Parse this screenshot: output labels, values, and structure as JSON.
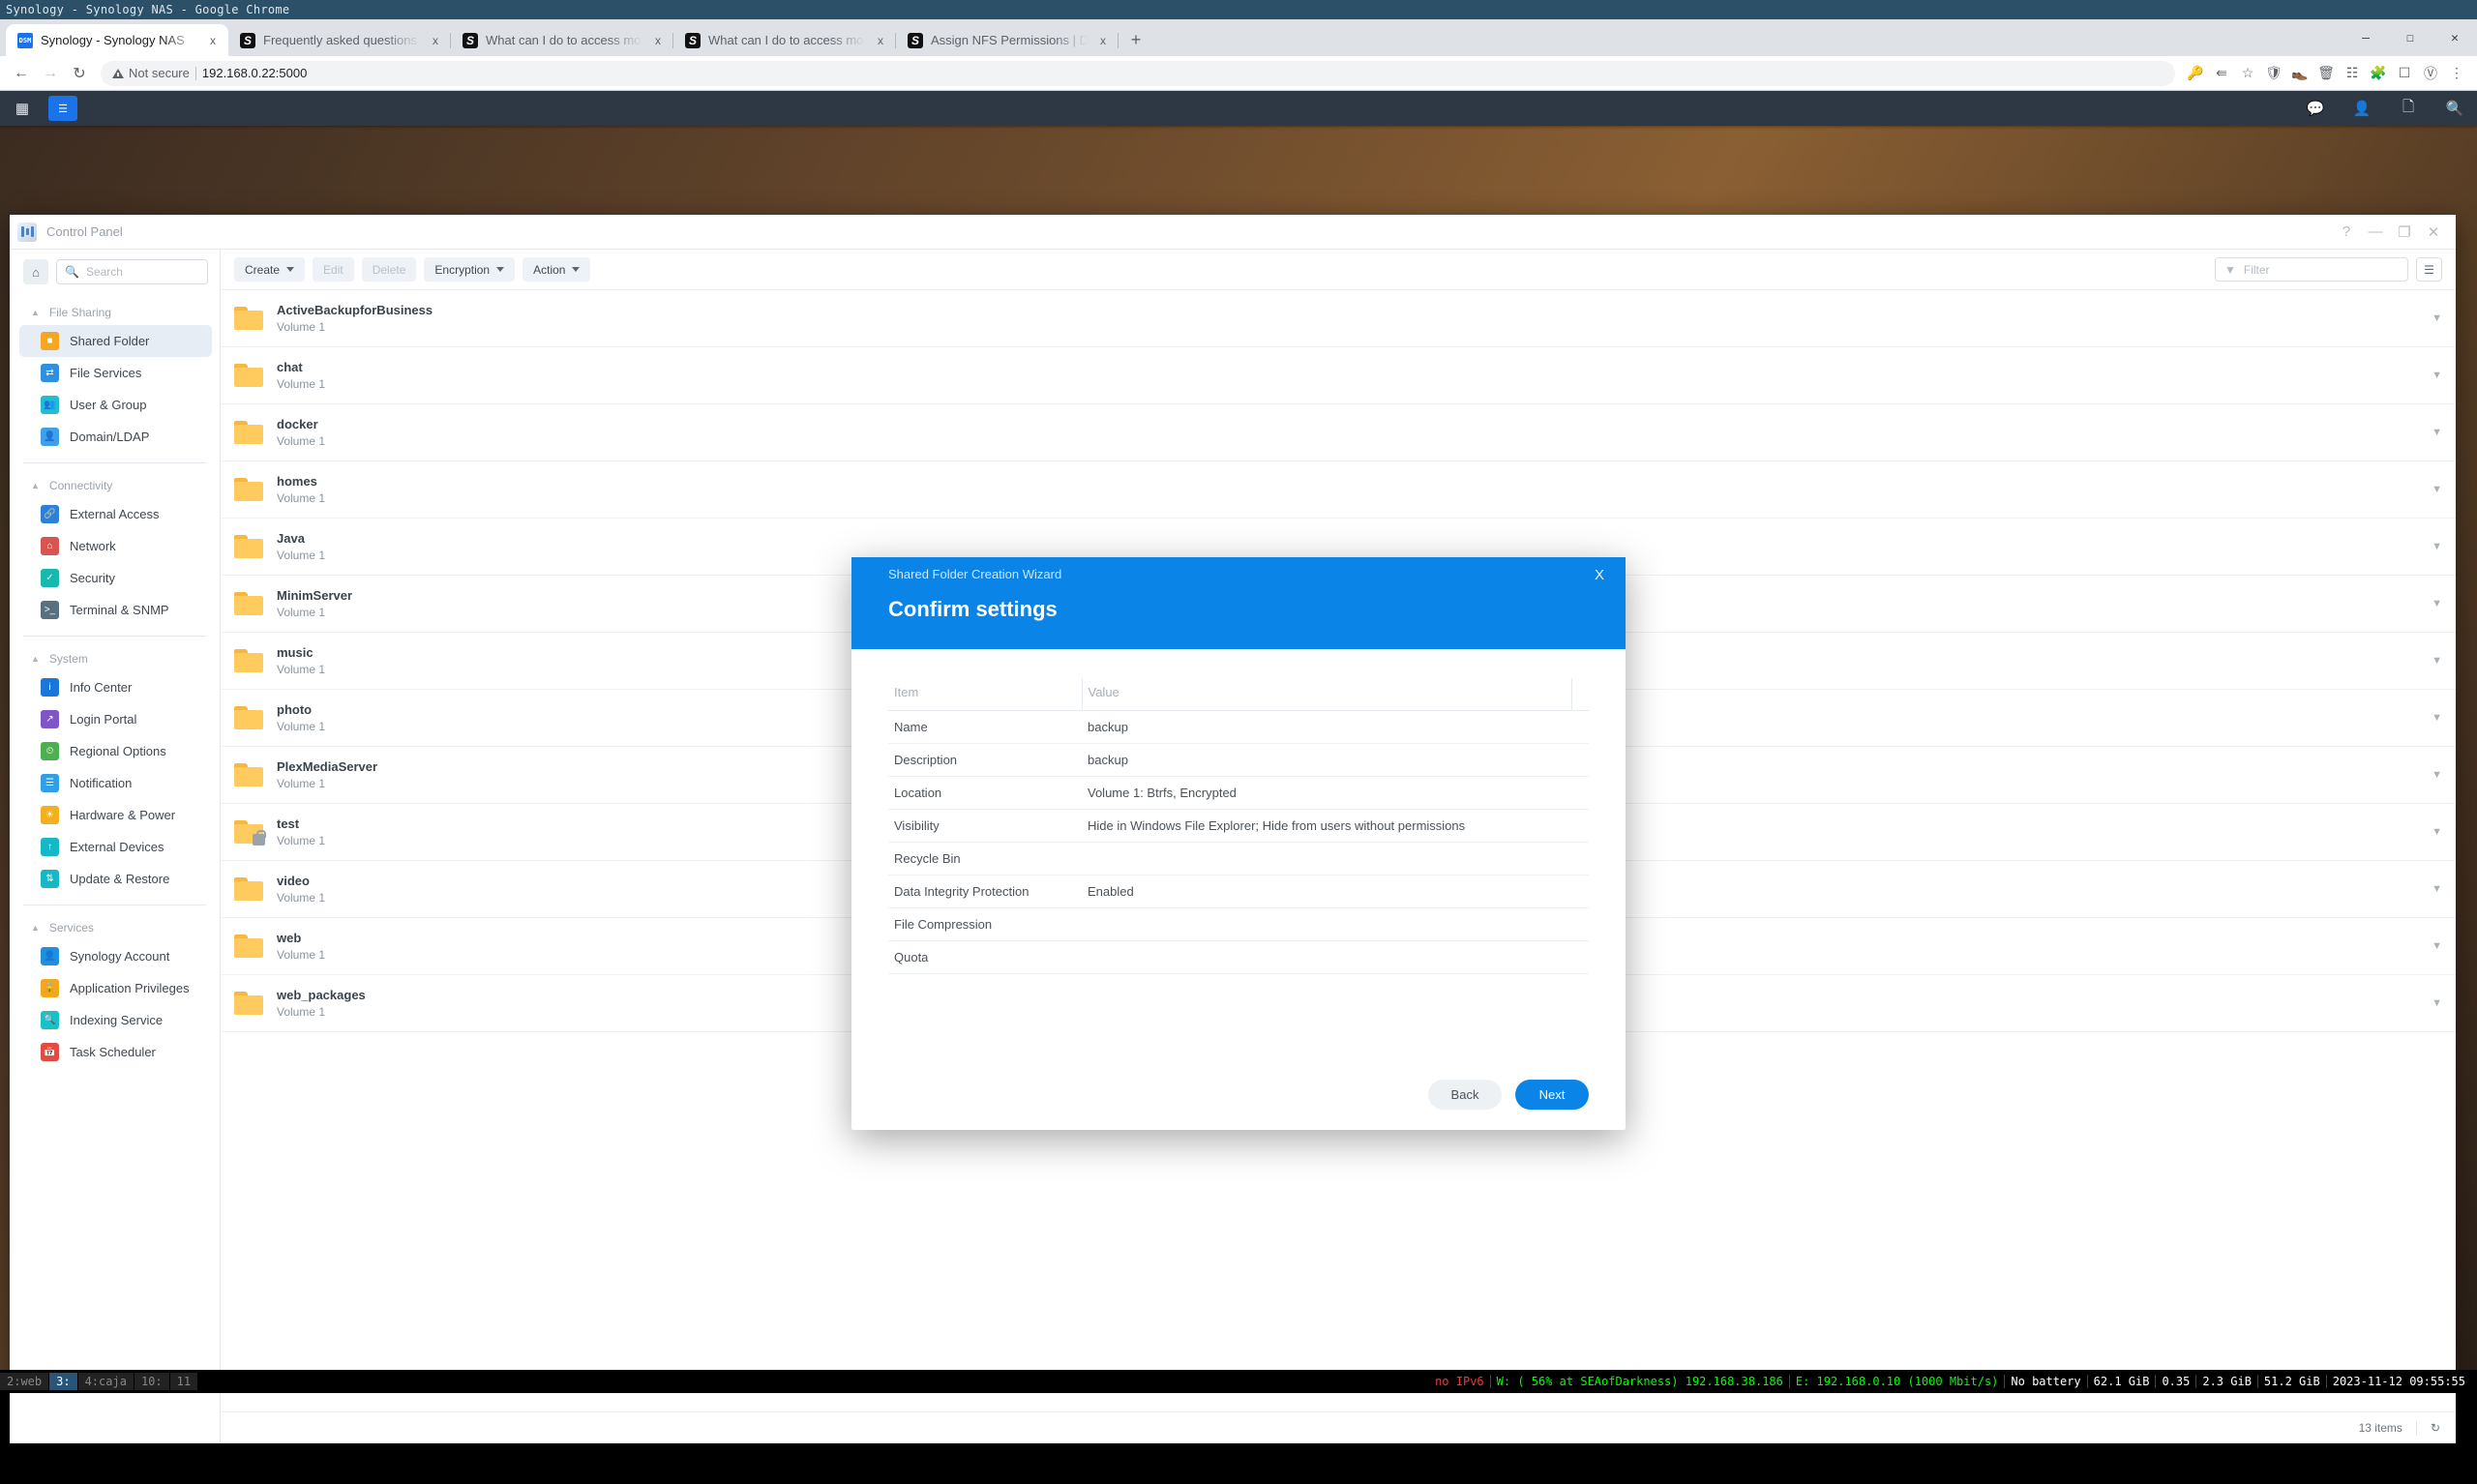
{
  "chrome": {
    "window_title": "Synology - Synology NAS - Google Chrome",
    "tabs": [
      {
        "title": "Synology - Synology NAS",
        "favicon": "synology-icon",
        "active": true
      },
      {
        "title": "Frequently asked questions a",
        "favicon": "s-icon",
        "active": false
      },
      {
        "title": "What can I do to access mou",
        "favicon": "s-icon",
        "active": false
      },
      {
        "title": "What can I do to access mou",
        "favicon": "s-icon",
        "active": false
      },
      {
        "title": "Assign NFS Permissions | DS",
        "favicon": "s-icon",
        "active": false
      }
    ],
    "close_label": "x",
    "new_tab_label": "+",
    "window_buttons": [
      "—",
      "☐",
      "✕"
    ],
    "nav": {
      "back": "←",
      "forward": "→",
      "reload": "↻"
    },
    "omnibox": {
      "security_text": "Not secure",
      "url": "192.168.0.22:5000"
    },
    "toolbar_icons": [
      "key-icon",
      "share-icon",
      "star-icon",
      "ublock-icon",
      "shoe-icon",
      "trash-icon",
      "equalizer-icon",
      "extensions-icon",
      "sidepanel-icon",
      "profile-icon",
      "menu-icon"
    ]
  },
  "dsm_taskbar": {
    "left_icons": [
      "apps-grid-icon",
      "control-panel-app-icon"
    ],
    "right_icons": [
      "chat-icon",
      "user-icon",
      "notifications-icon",
      "search-icon"
    ]
  },
  "control_panel": {
    "title": "Control Panel",
    "window_buttons": [
      "?",
      "—",
      "❐",
      "✕"
    ],
    "search_placeholder": "Search",
    "home_icon": "home-icon",
    "search_icon": "search-icon",
    "sidebar": [
      {
        "group": "File Sharing",
        "items": [
          {
            "label": "Shared Folder",
            "icon": "shared-folder-icon",
            "color": "#f5a623",
            "selected": true
          },
          {
            "label": "File Services",
            "icon": "file-services-icon",
            "color": "#2f8fe0",
            "selected": false
          },
          {
            "label": "User & Group",
            "icon": "user-group-icon",
            "color": "#1fbcd2",
            "selected": false
          },
          {
            "label": "Domain/LDAP",
            "icon": "domain-ldap-icon",
            "color": "#3f9fe8",
            "selected": false
          }
        ]
      },
      {
        "group": "Connectivity",
        "items": [
          {
            "label": "External Access",
            "icon": "external-access-icon",
            "color": "#2f7fd6",
            "selected": false
          },
          {
            "label": "Network",
            "icon": "network-icon",
            "color": "#d9534f",
            "selected": false
          },
          {
            "label": "Security",
            "icon": "security-icon",
            "color": "#17b8ae",
            "selected": false
          },
          {
            "label": "Terminal & SNMP",
            "icon": "terminal-snmp-icon",
            "color": "#58707f",
            "selected": false
          }
        ]
      },
      {
        "group": "System",
        "items": [
          {
            "label": "Info Center",
            "icon": "info-center-icon",
            "color": "#1b76d9",
            "selected": false
          },
          {
            "label": "Login Portal",
            "icon": "login-portal-icon",
            "color": "#8055c8",
            "selected": false
          },
          {
            "label": "Regional Options",
            "icon": "regional-options-icon",
            "color": "#4caf50",
            "selected": false
          },
          {
            "label": "Notification",
            "icon": "notification-icon",
            "color": "#2f9fe8",
            "selected": false
          },
          {
            "label": "Hardware & Power",
            "icon": "hardware-power-icon",
            "color": "#f2b01e",
            "selected": false
          },
          {
            "label": "External Devices",
            "icon": "external-devices-icon",
            "color": "#17b8c5",
            "selected": false
          },
          {
            "label": "Update & Restore",
            "icon": "update-restore-icon",
            "color": "#17b8c5",
            "selected": false
          }
        ]
      },
      {
        "group": "Services",
        "items": [
          {
            "label": "Synology Account",
            "icon": "synology-account-icon",
            "color": "#1f8fe0",
            "selected": false
          },
          {
            "label": "Application Privileges",
            "icon": "application-privileges-icon",
            "color": "#f2a71e",
            "selected": false
          },
          {
            "label": "Indexing Service",
            "icon": "indexing-service-icon",
            "color": "#18c0c7",
            "selected": false
          },
          {
            "label": "Task Scheduler",
            "icon": "task-scheduler-icon",
            "color": "#e04b42",
            "selected": false
          }
        ]
      }
    ],
    "toolbar": {
      "create": "Create",
      "edit": "Edit",
      "delete": "Delete",
      "encryption": "Encryption",
      "action": "Action",
      "filter_placeholder": "Filter",
      "filter_icon": "funnel-icon",
      "list_view_icon": "list-view-icon"
    },
    "folders": [
      {
        "name": "ActiveBackupforBusiness",
        "volume": "Volume 1",
        "locked": false
      },
      {
        "name": "chat",
        "volume": "Volume 1",
        "locked": false
      },
      {
        "name": "docker",
        "volume": "Volume 1",
        "locked": false
      },
      {
        "name": "homes",
        "volume": "Volume 1",
        "locked": false
      },
      {
        "name": "Java",
        "volume": "Volume 1",
        "locked": false
      },
      {
        "name": "MinimServer",
        "volume": "Volume 1",
        "locked": false
      },
      {
        "name": "music",
        "volume": "Volume 1",
        "locked": false
      },
      {
        "name": "photo",
        "volume": "Volume 1",
        "locked": false
      },
      {
        "name": "PlexMediaServer",
        "volume": "Volume 1",
        "locked": false
      },
      {
        "name": "test",
        "volume": "Volume 1",
        "locked": true
      },
      {
        "name": "video",
        "volume": "Volume 1",
        "locked": false
      },
      {
        "name": "web",
        "volume": "Volume 1",
        "locked": false
      },
      {
        "name": "web_packages",
        "volume": "Volume 1",
        "locked": false
      }
    ],
    "status": {
      "item_count": "13 items",
      "refresh_icon": "refresh-icon"
    }
  },
  "modal": {
    "wizard_name": "Shared Folder Creation Wizard",
    "title": "Confirm settings",
    "close_label": "X",
    "accent_color": "#0b84e8",
    "table": {
      "headers": [
        "Item",
        "Value"
      ],
      "rows": [
        {
          "item": "Name",
          "value": "backup"
        },
        {
          "item": "Description",
          "value": "backup"
        },
        {
          "item": "Location",
          "value": "Volume 1: Btrfs, Encrypted"
        },
        {
          "item": "Visibility",
          "value": "Hide in Windows File Explorer; Hide from users without permissions"
        },
        {
          "item": "Recycle Bin",
          "value": ""
        },
        {
          "item": "Data Integrity Protection",
          "value": "Enabled"
        },
        {
          "item": "File Compression",
          "value": ""
        },
        {
          "item": "Quota",
          "value": ""
        }
      ]
    },
    "buttons": {
      "back": "Back",
      "next": "Next"
    }
  },
  "i3bar": {
    "workspaces": [
      {
        "label": "2:web",
        "active": false
      },
      {
        "label": "3:",
        "active": true
      },
      {
        "label": "4:caja",
        "active": false
      },
      {
        "label": "10:",
        "active": false
      },
      {
        "label": "11",
        "active": false
      }
    ],
    "status": [
      {
        "text": "no IPv6",
        "color": "#ff3333"
      },
      {
        "text": "W: ( 56% at SEAofDarkness) 192.168.38.186",
        "color": "#00ff00"
      },
      {
        "text": "E: 192.168.0.10 (1000 Mbit/s)",
        "color": "#00ff00"
      },
      {
        "text": "No battery",
        "color": "#ffffff"
      },
      {
        "text": "62.1 GiB",
        "color": "#ffffff"
      },
      {
        "text": "0.35",
        "color": "#ffffff"
      },
      {
        "text": "2.3 GiB",
        "color": "#ffffff"
      },
      {
        "text": "51.2 GiB",
        "color": "#ffffff"
      },
      {
        "text": "2023-11-12 09:55:55",
        "color": "#ffffff"
      }
    ]
  }
}
